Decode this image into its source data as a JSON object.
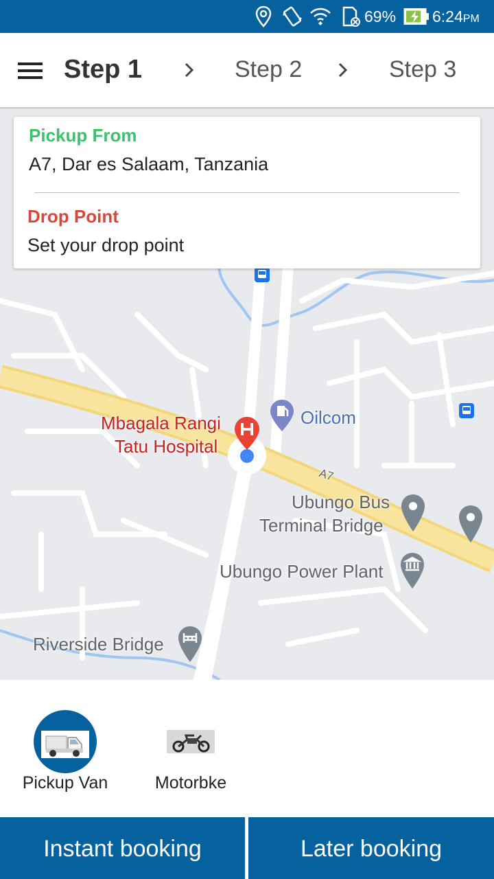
{
  "status_bar": {
    "battery_percent": "69%",
    "time": "6:24",
    "ampm": "PM",
    "icons": [
      "location-icon",
      "vibrate-icon",
      "wifi-icon",
      "sim-icon",
      "battery-charging-icon"
    ],
    "background_color": "#06629f"
  },
  "header": {
    "menu_icon": "hamburger-menu-icon",
    "steps": [
      "Step 1",
      "Step 2",
      "Step 3"
    ],
    "active_step": 1
  },
  "address_card": {
    "pickup_label": "Pickup From",
    "pickup_address": "A7, Dar es Salaam, Tanzania",
    "drop_label": "Drop Point",
    "drop_placeholder": "Set your drop point",
    "pickup_color": "#3cc26d",
    "drop_color": "#d8473c"
  },
  "map": {
    "labels": {
      "hospital_line1": "Mbagala Rangi",
      "hospital_line2": "Tatu Hospital",
      "oilcom": "Oilcom",
      "bus_terminal_line1": "Ubungo Bus",
      "bus_terminal_line2": "Terminal Bridge",
      "power_plant": "Ubungo Power Plant",
      "riverside": "Riverside Bridge",
      "road": "A7"
    }
  },
  "vehicles": [
    {
      "label": "Pickup Van",
      "selected": true
    },
    {
      "label": "Motorbke",
      "selected": false
    }
  ],
  "booking": {
    "instant_label": "Instant booking",
    "later_label": "Later booking",
    "button_color": "#06629f"
  }
}
